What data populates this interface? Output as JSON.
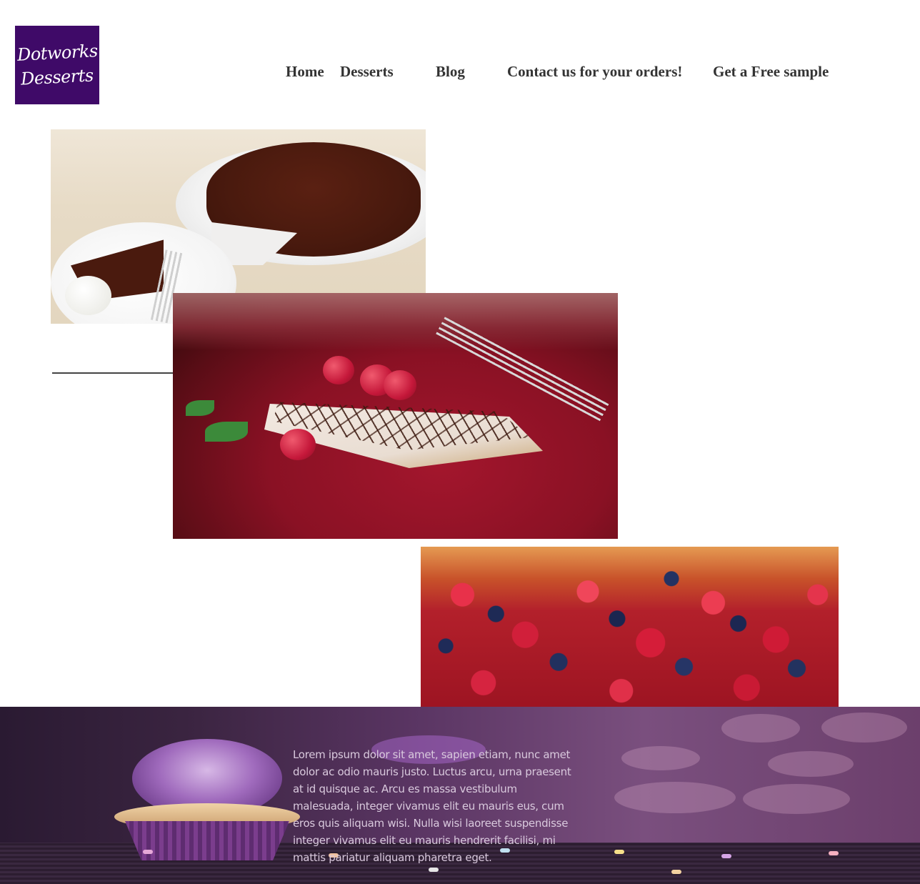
{
  "brand": {
    "logo_line1": "Dotworks",
    "logo_line2": "Desserts",
    "logo_color": "#3f0a68"
  },
  "nav": {
    "items": [
      {
        "label": "Home"
      },
      {
        "label": "Desserts"
      },
      {
        "label": "Blog"
      },
      {
        "label": "Contact us for your orders!"
      },
      {
        "label": "Get a Free sample"
      }
    ]
  },
  "gallery": {
    "images": [
      {
        "subject": "chocolate cake on cake stand with slice and ice cream"
      },
      {
        "subject": "cheesecake slice with raspberries and chocolate drizzle on red plate"
      },
      {
        "subject": "mixed berry tart with strawberries, raspberries and blueberries"
      }
    ]
  },
  "footer": {
    "text": "Lorem ipsum dolor sit amet, sapien etiam, nunc amet dolor ac odio mauris justo. Luctus arcu, urna praesent at id quisque ac. Arcu es massa vestibulum malesuada, integer vivamus elit eu mauris eus, cum eros quis aliquam wisi. Nulla wisi laoreet suspendisse integer vivamus elit eu mauris hendrerit facilisi, mi mattis pariatur aliquam pharetra eget.",
    "background_subject": "purple cupcake with bokeh background"
  }
}
